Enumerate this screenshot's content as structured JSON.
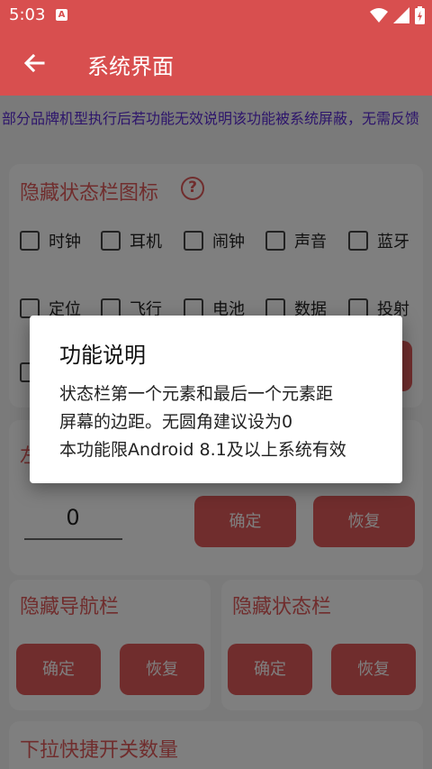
{
  "status_bar": {
    "time": "5:03",
    "notification_icon": "A"
  },
  "app_bar": {
    "title": "系统界面"
  },
  "notice": "部分品牌机型执行后若功能无效说明该功能被系统屏蔽，无需反馈",
  "hide_status_icons": {
    "title": "隐藏状态栏图标",
    "help_glyph": "?",
    "items": [
      "时钟",
      "耳机",
      "闹钟",
      "声音",
      "蓝牙",
      "定位",
      "飞行",
      "电池",
      "数据",
      "投射"
    ]
  },
  "margin_card": {
    "title_partial": "左",
    "value": "0",
    "confirm": "确定",
    "restore": "恢复"
  },
  "hide_nav_bar": {
    "title": "隐藏导航栏",
    "confirm": "确定",
    "restore": "恢复"
  },
  "hide_status_bar": {
    "title": "隐藏状态栏",
    "confirm": "确定",
    "restore": "恢复"
  },
  "quick_tiles": {
    "title": "下拉快捷开关数量"
  },
  "dialog": {
    "title": "功能说明",
    "lines": [
      "状态栏第一个元素和最后一个元素距",
      "屏幕的边距。无圆角建议设为0",
      "本功能限Android 8.1及以上系统有效"
    ]
  },
  "colors": {
    "primary": "#d84f4f",
    "accent": "#e05a5a",
    "notice": "#5a2bd6"
  },
  "icons": [
    "back-arrow-icon",
    "wifi-icon",
    "signal-icon",
    "battery-charging-icon",
    "help-icon"
  ]
}
